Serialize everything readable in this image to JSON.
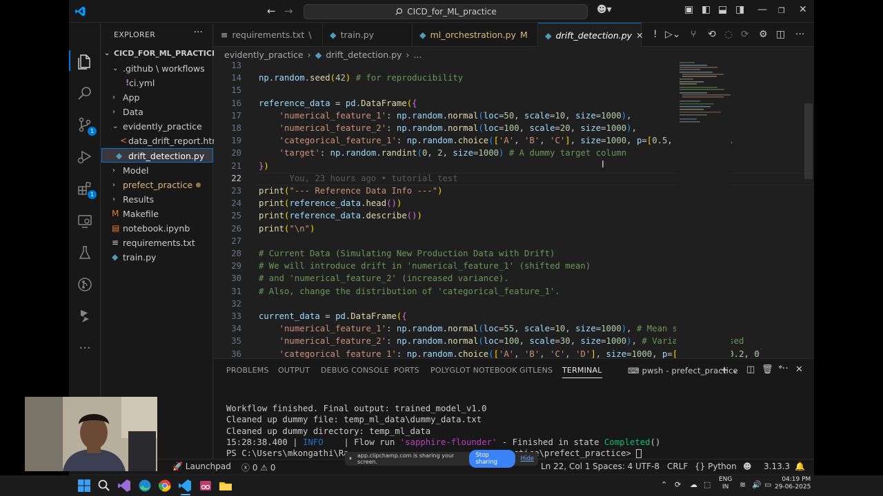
{
  "titlebar": {
    "search_text": "CICD_for_ML_practice"
  },
  "sidebar": {
    "header": "EXPLORER",
    "root": "CICD_FOR_ML_PRACTICE",
    "items": [
      {
        "label": ".github \\ workflows",
        "type": "folder-open"
      },
      {
        "label": "ci.yml",
        "type": "yml"
      },
      {
        "label": "App",
        "type": "folder"
      },
      {
        "label": "Data",
        "type": "folder"
      },
      {
        "label": "evidently_practice",
        "type": "folder-open"
      },
      {
        "label": "data_drift_report.html",
        "type": "html"
      },
      {
        "label": "drift_detection.py",
        "type": "py"
      },
      {
        "label": "Model",
        "type": "folder"
      },
      {
        "label": "prefect_practice",
        "type": "folder"
      },
      {
        "label": "Results",
        "type": "folder"
      },
      {
        "label": "Makefile",
        "type": "makefile"
      },
      {
        "label": "notebook.ipynb",
        "type": "ipynb"
      },
      {
        "label": "requirements.txt",
        "type": "txt"
      },
      {
        "label": "train.py",
        "type": "py"
      }
    ]
  },
  "tabs": [
    {
      "label": "requirements.txt",
      "suffix": "\\"
    },
    {
      "label": "train.py",
      "suffix": ""
    },
    {
      "label": "ml_orchestration.py",
      "suffix": "M"
    },
    {
      "label": "drift_detection.py",
      "suffix": ""
    }
  ],
  "breadcrumb": {
    "folder": "evidently_practice",
    "file": "drift_detection.py",
    "more": "..."
  },
  "editor": {
    "line_numbers": [
      "13",
      "14",
      "15",
      "16",
      "17",
      "18",
      "19",
      "20",
      "21",
      "22",
      "23",
      "24",
      "25",
      "26",
      "27",
      "28",
      "29",
      "30",
      "31",
      "32",
      "33",
      "34",
      "35",
      "36"
    ],
    "blame": "You, 23 hours ago • tutorial test"
  },
  "panel": {
    "tabs": [
      "PROBLEMS",
      "OUTPUT",
      "DEBUG CONSOLE",
      "PORTS",
      "POLYGLOT NOTEBOOK",
      "GITLENS",
      "TERMINAL"
    ],
    "terminal_name": "pwsh - prefect_practice",
    "lines": [
      "Workflow finished. Final output: trained_model_v1.0",
      "Cleaned up dummy file: temp_ml_data\\dummy_data.txt",
      "Cleaned up dummy directory: temp_ml_data"
    ],
    "flow_time": "15:28:38.400",
    "flow_level": "INFO",
    "flow_text_a": "| Flow run ",
    "flow_name": "'sapphire-flounder'",
    "flow_text_b": " - Finished in state ",
    "flow_state": "Completed",
    "flow_text_c": "()",
    "prompt_a": "PS C:\\Users\\mkongathi\\Ra",
    "prompt_b": "ractice\\prefect_practice> "
  },
  "statusbar": {
    "launchpad": "Launchpad",
    "problems": "0",
    "warnings": "0",
    "position": "Ln 22, Col 1",
    "spaces": "Spaces: 4",
    "encoding": "UTF-8",
    "eol": "CRLF",
    "language": "Python",
    "python_version": "3.13.3"
  },
  "share_banner": {
    "text": "app.clipchamp.com is sharing your screen.",
    "stop": "Stop sharing",
    "hide": "Hide"
  },
  "taskbar": {
    "lang": "ENG",
    "region": "IN",
    "time": "04:19 PM",
    "date": "29-06-2025"
  },
  "colors": {
    "accent": "#0078d4",
    "editor_bg": "#1f1f1f",
    "sidebar_bg": "#181818"
  }
}
